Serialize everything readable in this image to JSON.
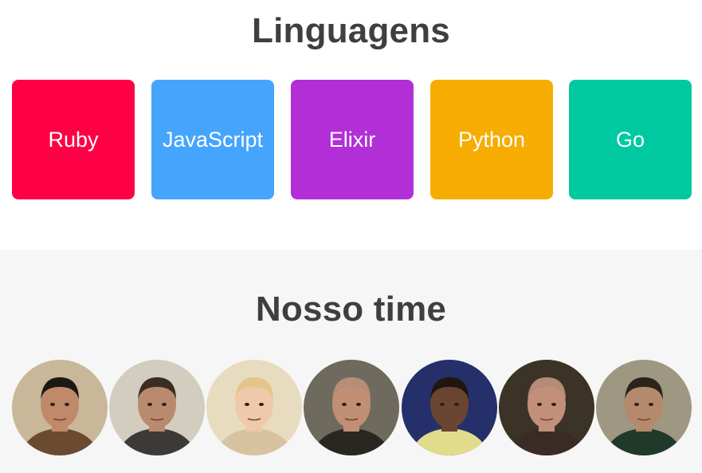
{
  "languages": {
    "title": "Linguagens",
    "items": [
      {
        "label": "Ruby",
        "color": "#fe0044"
      },
      {
        "label": "JavaScript",
        "color": "#45a5fd"
      },
      {
        "label": "Elixir",
        "color": "#b22fd8"
      },
      {
        "label": "Python",
        "color": "#f7ac02"
      },
      {
        "label": "Go",
        "color": "#00c9a2"
      }
    ]
  },
  "team": {
    "title": "Nosso time",
    "members": [
      {
        "avatar": "avatar-photo",
        "bg": "#c9b79a",
        "skin": "#c08a6a",
        "hair": "#1c1814",
        "shirt": "#6b4a32"
      },
      {
        "avatar": "avatar-photo",
        "bg": "#d3cdbf",
        "skin": "#b98a6e",
        "hair": "#3a2e24",
        "shirt": "#3b3a36"
      },
      {
        "avatar": "avatar-photo",
        "bg": "#e8dcc0",
        "skin": "#efc9aa",
        "hair": "#e3c78a",
        "shirt": "#d7c3a0"
      },
      {
        "avatar": "avatar-photo",
        "bg": "#6f6a5e",
        "skin": "#c08f74",
        "hair": "#b58d78",
        "shirt": "#2a2622"
      },
      {
        "avatar": "avatar-photo",
        "bg": "#25306a",
        "skin": "#6a4532",
        "hair": "#20160f",
        "shirt": "#e2dc8a"
      },
      {
        "avatar": "avatar-photo",
        "bg": "#3c3327",
        "skin": "#c2907a",
        "hair": "#b48a78",
        "shirt": "#3a2c24"
      },
      {
        "avatar": "avatar-photo",
        "bg": "#9e9782",
        "skin": "#b58a6c",
        "hair": "#2a241c",
        "shirt": "#1f3a2a"
      }
    ]
  }
}
